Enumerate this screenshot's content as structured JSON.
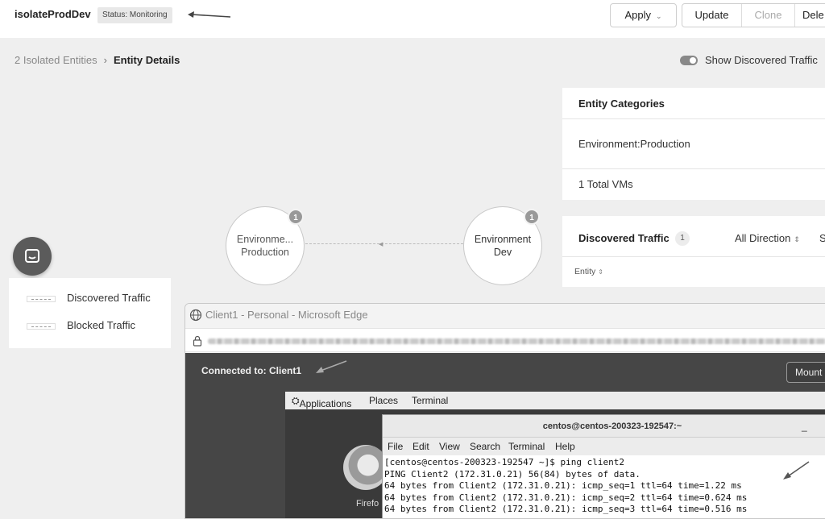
{
  "header": {
    "policy_name": "isolateProdDev",
    "status": "Status: Monitoring",
    "apply_label": "Apply",
    "update_label": "Update",
    "clone_label": "Clone",
    "delete_label": "Dele"
  },
  "breadcrumb": {
    "parent": "2 Isolated Entities",
    "separator": "›",
    "current": "Entity Details"
  },
  "toggle": {
    "label": "Show Discovered Traffic",
    "on": true
  },
  "graph": {
    "nodes": [
      {
        "line1": "Environme...",
        "line2": "Production",
        "count": "1"
      },
      {
        "line1": "Environment",
        "line2": "Dev",
        "count": "1"
      }
    ]
  },
  "legend": {
    "discovered": "Discovered Traffic",
    "blocked": "Blocked Traffic"
  },
  "categories_panel": {
    "title": "Entity Categories",
    "category": "Environment:Production",
    "vms": "1 Total VMs"
  },
  "traffic_panel": {
    "title": "Discovered Traffic",
    "count": "1",
    "direction": "All Direction",
    "direction_caret": "⇕",
    "extra": "S",
    "column_entity": "Entity",
    "column_caret": "⇕"
  },
  "browser": {
    "title": "Client1 - Personal - Microsoft Edge"
  },
  "remote": {
    "connected": "Connected to: Client1",
    "mount_label": "Mount"
  },
  "desktop": {
    "menu_applications": "Applications",
    "menu_places": "Places",
    "menu_terminal": "Terminal",
    "firefox_label": "Firefo"
  },
  "terminal": {
    "title": "centos@centos-200323-192547:~",
    "minimize": "_",
    "menu": [
      "File",
      "Edit",
      "View",
      "Search",
      "Terminal",
      "Help"
    ],
    "lines": [
      "[centos@centos-200323-192547 ~]$ ping client2",
      "PING Client2 (172.31.0.21) 56(84) bytes of data.",
      "64 bytes from Client2 (172.31.0.21): icmp_seq=1 ttl=64 time=1.22 ms",
      "64 bytes from Client2 (172.31.0.21): icmp_seq=2 ttl=64 time=0.624 ms",
      "64 bytes from Client2 (172.31.0.21): icmp_seq=3 ttl=64 time=0.516 ms"
    ]
  }
}
